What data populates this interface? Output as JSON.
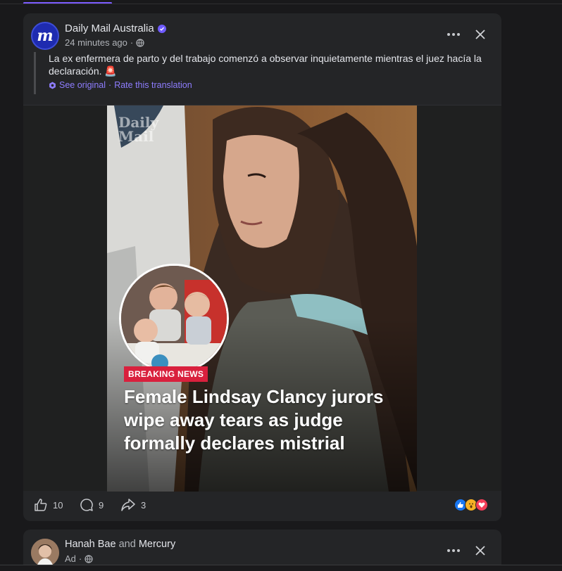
{
  "post": {
    "page_name": "Daily Mail Australia",
    "time": "24 minutes ago",
    "time_separator": "·",
    "text": "La ex enfermera de parto y del trabajo comenzó a observar inquietamente mientras el juez hacía la declaración. 🚨",
    "see_original": "See original",
    "link_separator": "·",
    "rate_translation": "Rate this translation",
    "avatar_letter": "m",
    "image": {
      "watermark_line1": "Daily",
      "watermark_line2": "Mail",
      "badge": "BREAKING NEWS",
      "headline": "Female Lindsay Clancy jurors wipe away tears as judge formally declares mistrial"
    },
    "actions": {
      "likes": "10",
      "comments": "9",
      "shares": "3"
    },
    "reactions": [
      "like-icon",
      "wow-icon",
      "love-icon"
    ]
  },
  "next_post": {
    "name1": "Hanah Bae",
    "and": "and",
    "name2": "Mercury",
    "label": "Ad",
    "separator": "·"
  },
  "colors": {
    "accent": "#7c5cff",
    "badge": "#d9203d",
    "like": "#1877f2",
    "love": "#f33e58",
    "wow": "#f7b125"
  }
}
